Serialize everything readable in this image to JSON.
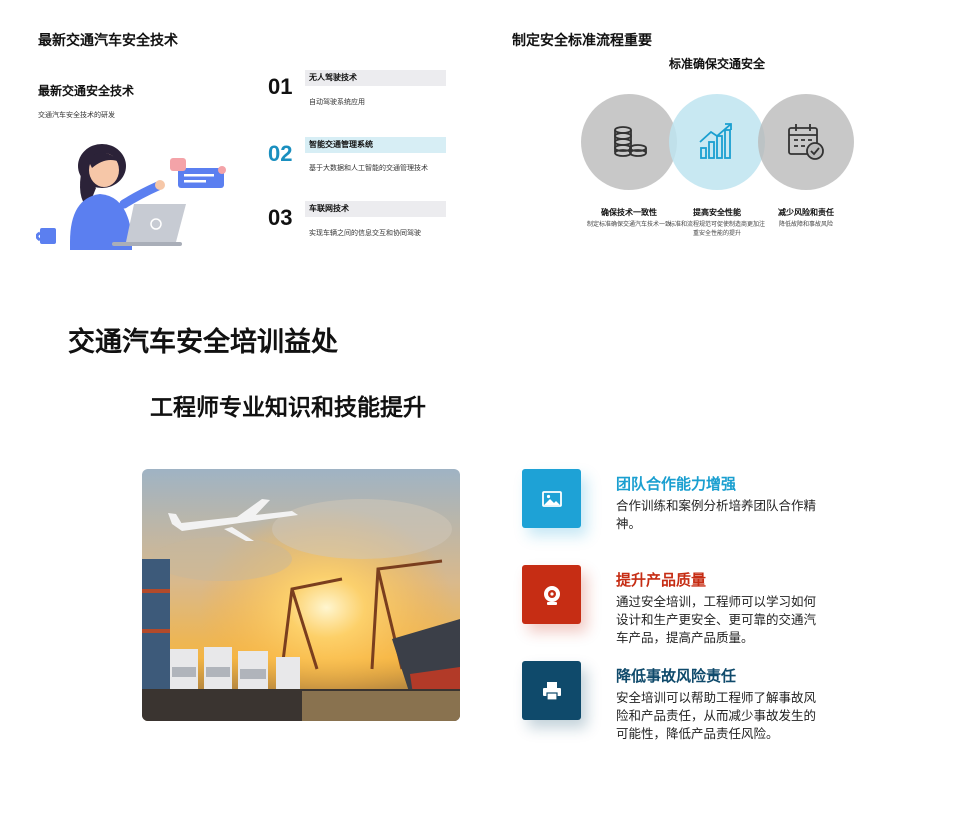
{
  "top_left": {
    "title": "最新交通汽车安全技术",
    "subtitle": "最新交通安全技术",
    "description": "交通汽车安全技术的研发",
    "steps": [
      {
        "number": "01",
        "heading": "无人驾驶技术",
        "text": "自动驾驶系统应用"
      },
      {
        "number": "02",
        "heading": "智能交通管理系统",
        "text": "基于大数据和人工智能的交通管理技术"
      },
      {
        "number": "03",
        "heading": "车联网技术",
        "text": "实现车辆之间的信息交互和协同驾驶"
      }
    ],
    "colors": {
      "highlight_number": "#1a8fbf",
      "highlight_bar": "#d7eef5",
      "bar": "#ececef"
    }
  },
  "top_right": {
    "title": "制定安全标准流程重要",
    "subtitle": "标准确保交通安全",
    "features": [
      {
        "icon": "coins-icon",
        "heading": "确保技术一致性",
        "text": "制定标准确保交通汽车技术一致"
      },
      {
        "icon": "growth-chart-icon",
        "heading": "提高安全性能",
        "text": "标准和流程规范可促使制造商更加注重安全性能的提升"
      },
      {
        "icon": "calendar-check-icon",
        "heading": "减少风险和责任",
        "text": "降低故障和事故风险"
      }
    ]
  },
  "bottom": {
    "title": "交通汽车安全培训益处",
    "subtitle": "工程师专业知识和技能提升",
    "image": "cargo-port-photo",
    "benefits": [
      {
        "icon": "image-icon",
        "heading": "团队合作能力增强",
        "text": "合作训练和案例分析培养团队合作精神。",
        "color": "#1ea2d6"
      },
      {
        "icon": "target-icon",
        "heading": "提升产品质量",
        "text": "通过安全培训，工程师可以学习如何设计和生产更安全、更可靠的交通汽车产品，提高产品质量。",
        "color": "#c62d14"
      },
      {
        "icon": "printer-icon",
        "heading": "降低事故风险责任",
        "text": "安全培训可以帮助工程师了解事故风险和产品责任，从而减少事故发生的可能性，降低产品责任风险。",
        "color": "#0f4a6b"
      }
    ]
  }
}
